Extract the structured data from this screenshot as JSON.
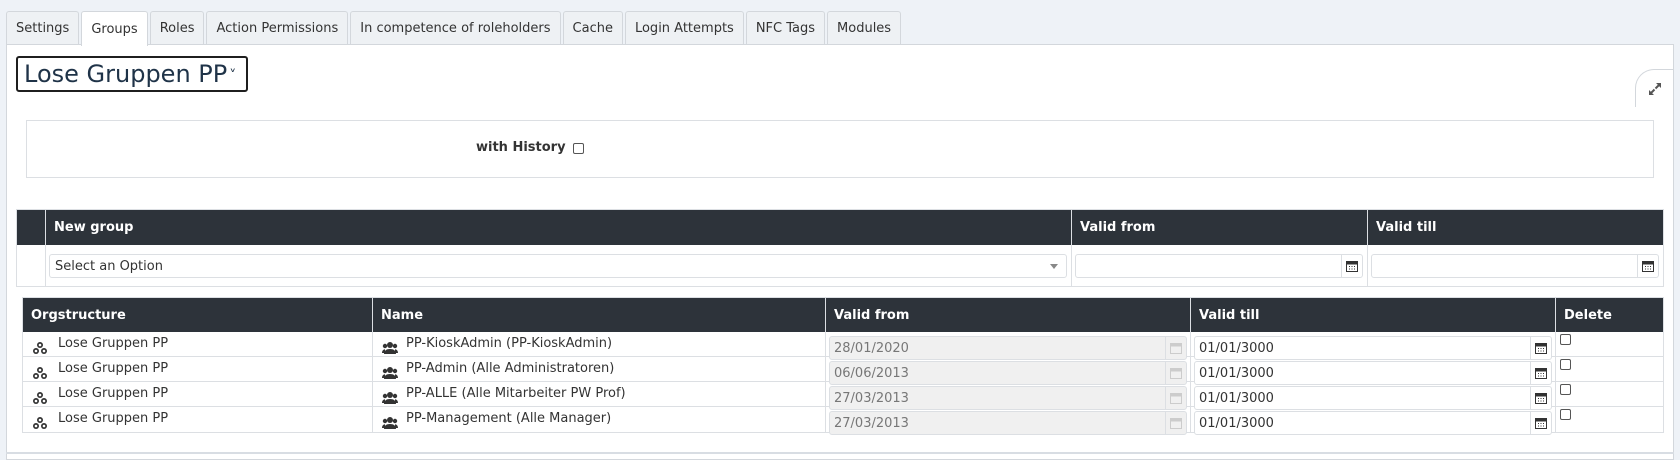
{
  "tabs": [
    {
      "label": "Settings",
      "active": false
    },
    {
      "label": "Groups",
      "active": true
    },
    {
      "label": "Roles",
      "active": false
    },
    {
      "label": "Action Permissions",
      "active": false
    },
    {
      "label": "In competence of roleholders",
      "active": false
    },
    {
      "label": "Cache",
      "active": false
    },
    {
      "label": "Login Attempts",
      "active": false
    },
    {
      "label": "NFC Tags",
      "active": false
    },
    {
      "label": "Modules",
      "active": false
    }
  ],
  "group_selector": {
    "value": "Lose Gruppen PP",
    "chevron": "˅"
  },
  "history": {
    "label": "with History",
    "checked": false
  },
  "new_group": {
    "headers": {
      "group": "New group",
      "valid_from": "Valid from",
      "valid_till": "Valid till"
    },
    "select_placeholder": "Select an Option",
    "valid_from_value": "",
    "valid_till_value": ""
  },
  "table": {
    "headers": {
      "orgstructure": "Orgstructure",
      "name": "Name",
      "valid_from": "Valid from",
      "valid_till": "Valid till",
      "delete": "Delete"
    },
    "rows": [
      {
        "org": "Lose Gruppen PP",
        "name": "PP-KioskAdmin (PP-KioskAdmin)",
        "valid_from": "28/01/2020",
        "valid_till": "01/01/3000",
        "delete": false
      },
      {
        "org": "Lose Gruppen PP",
        "name": "PP-Admin (Alle Administratoren)",
        "valid_from": "06/06/2013",
        "valid_till": "01/01/3000",
        "delete": false
      },
      {
        "org": "Lose Gruppen PP",
        "name": "PP-ALLE (Alle Mitarbeiter PW Prof)",
        "valid_from": "27/03/2013",
        "valid_till": "01/01/3000",
        "delete": false
      },
      {
        "org": "Lose Gruppen PP",
        "name": "PP-Management (Alle Manager)",
        "valid_from": "27/03/2013",
        "valid_till": "01/01/3000",
        "delete": false
      }
    ]
  },
  "colors": {
    "header_bg": "#2d333a",
    "page_bg": "#eef2f7",
    "border": "#dcdfe3"
  },
  "icons": {
    "expand": "expand-icon",
    "calendar": "calendar-icon",
    "orgstructure": "org-structure-icon",
    "group": "users-group-icon"
  }
}
